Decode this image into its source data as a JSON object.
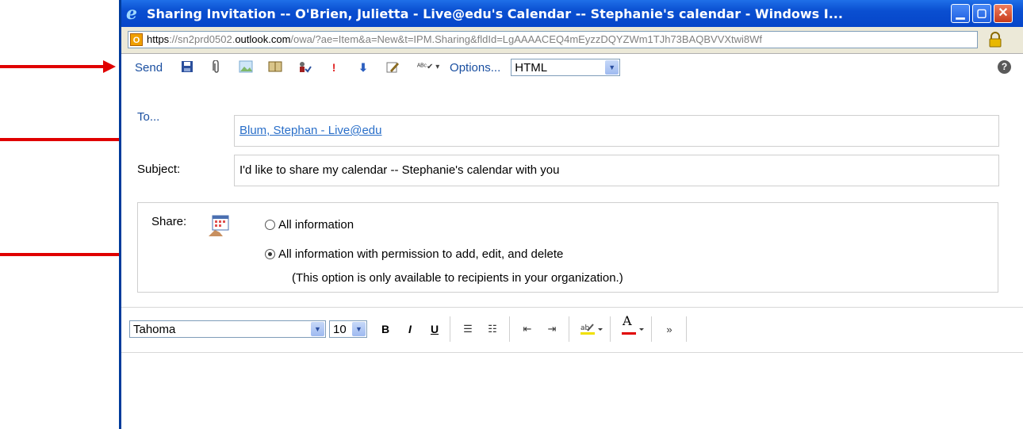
{
  "window": {
    "title": "Sharing Invitation -- O'Brien, Julietta - Live@edu's Calendar -- Stephanie's calendar - Windows I...",
    "min_glyph": "▁",
    "max_glyph": "▢",
    "close_glyph": "✕"
  },
  "address": {
    "scheme": "https",
    "host_prefix": "://sn2prd0502.",
    "domain": "outlook.com",
    "path": "/owa/?ae=Item&a=New&t=IPM.Sharing&fldId=LgAAAACEQ4mEyzzDQYZWm1TJh73BAQBVVXtwi8Wf"
  },
  "toolbar": {
    "send_label": "Send",
    "options_label": "Options...",
    "format_value": "HTML",
    "icons": [
      "save-icon",
      "attach-icon",
      "insert-image-icon",
      "address-book-icon",
      "check-names-icon",
      "high-importance-icon",
      "low-importance-icon",
      "signature-icon",
      "spelling-icon"
    ]
  },
  "fields": {
    "to_label": "To...",
    "to_value": "Blum, Stephan - Live@edu",
    "subject_label": "Subject:",
    "subject_value": "I'd like to share my calendar -- Stephanie's calendar with you"
  },
  "share": {
    "label": "Share:",
    "option_all": "All information",
    "option_edit": "All information with permission to add, edit, and delete",
    "note": "(This option is only available to recipients in your organization.)",
    "selected": "option_edit"
  },
  "format": {
    "font": "Tahoma",
    "size": "10",
    "bold": "B",
    "italic": "I",
    "underline": "U",
    "font_color_glyph": "A"
  },
  "colors": {
    "link": "#1a4fa0",
    "arrow": "#e00000",
    "title_bar": "#0a4fd1"
  }
}
